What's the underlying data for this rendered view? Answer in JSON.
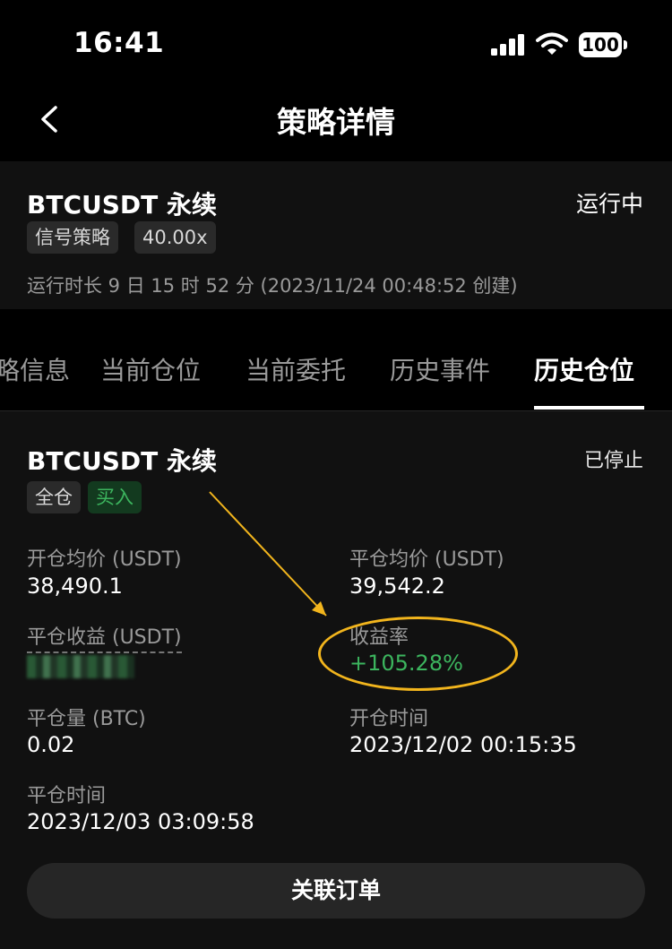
{
  "status_bar": {
    "time": "16:41",
    "battery": "100"
  },
  "nav": {
    "title": "策略详情"
  },
  "strategy": {
    "symbol": "BTCUSDT 永续",
    "status": "运行中",
    "tags": [
      "信号策略",
      "40.00x"
    ],
    "run_duration": "运行时长 9 日 15 时 52 分 (2023/11/24 00:48:52 创建)"
  },
  "tabs": [
    {
      "label": "略信息"
    },
    {
      "label": "当前仓位"
    },
    {
      "label": "当前委托"
    },
    {
      "label": "历史事件"
    },
    {
      "label": "历史仓位"
    }
  ],
  "position": {
    "symbol": "BTCUSDT 永续",
    "status": "已停止",
    "margin_tag": "全仓",
    "side_tag": "买入",
    "open_avg_label": "开仓均价 (USDT)",
    "open_avg_value": "38,490.1",
    "close_avg_label": "平仓均价 (USDT)",
    "close_avg_value": "39,542.2",
    "close_pnl_label": "平仓收益 (USDT)",
    "roi_label": "收益率",
    "roi_value": "+105.28%",
    "close_qty_label": "平仓量 (BTC)",
    "close_qty_value": "0.02",
    "open_time_label": "开仓时间",
    "open_time_value": "2023/12/02 00:15:35",
    "close_time_label": "平仓时间",
    "close_time_value": "2023/12/03 03:09:58"
  },
  "actions": {
    "linked_orders": "关联订单"
  },
  "colors": {
    "accent_green": "#3cb55e",
    "annotation_yellow": "#f2b51d",
    "card_bg": "#111111"
  },
  "icons": {
    "back": "chevron-left-icon",
    "signal": "cellular-signal-icon",
    "wifi": "wifi-icon",
    "battery": "battery-icon"
  }
}
